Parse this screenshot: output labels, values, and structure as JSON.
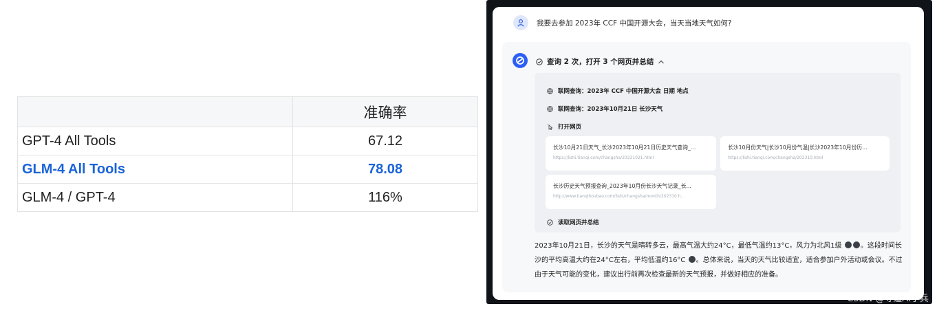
{
  "table": {
    "header": {
      "model": "",
      "metric": "准确率"
    },
    "rows": [
      {
        "model": "GPT-4 All Tools",
        "value": "67.12"
      },
      {
        "model": "GLM-4 All Tools",
        "value": "78.08"
      },
      {
        "model": "GLM-4 / GPT-4",
        "value": "116%"
      }
    ]
  },
  "chat": {
    "user_question": "我要去参加 2023年 CCF 中国开源大会，当天当地天气如何?",
    "summary_label": "查询 2 次，打开 3 个网页并总结",
    "steps": {
      "search1": "联网查询：2023年 CCF 中国开源大会 日期 地点",
      "search2": "联网查询：2023年10月21日 长沙天气",
      "open_pages": "打开网页",
      "read_summary": "读取网页并总结"
    },
    "pages": [
      {
        "title": "长沙10月21日天气_长沙2023年10月21日历史天气查询_...",
        "url": "https://lishi.tianqi.com/changsha/20231021.html"
      },
      {
        "title": "长沙10月份天气|长沙10月份气温|长沙2023年10月份历...",
        "url": "https://lishi.tianqi.com/changsha/202310.html"
      },
      {
        "title": "长沙历史天气预报查询_2023年10月份长沙天气记录_长...",
        "url": "http://www.tianqihoubao.com/lishi/changsha/month/202310.h..."
      }
    ],
    "answer": {
      "p1": "2023年10月21日，长沙的天气是晴转多云，最高气温大约24°C，最低气温约13°C，风力为北风1级",
      "p2": "。这段时间长沙的平均高温大约在24°C左右，平均低温约16°C",
      "p3": "。总体来说，当天的天气比较适宜，适合参加户外活动或会议。不过由于天气可能的变化，建议出行前再次检查最新的天气预报，并做好相应的准备。"
    }
  },
  "watermark": "CSDN @寻道AI小兵",
  "colors": {
    "accent": "#1a63d8",
    "bot_logo": "#2d5ff5",
    "frame": "#101318"
  }
}
